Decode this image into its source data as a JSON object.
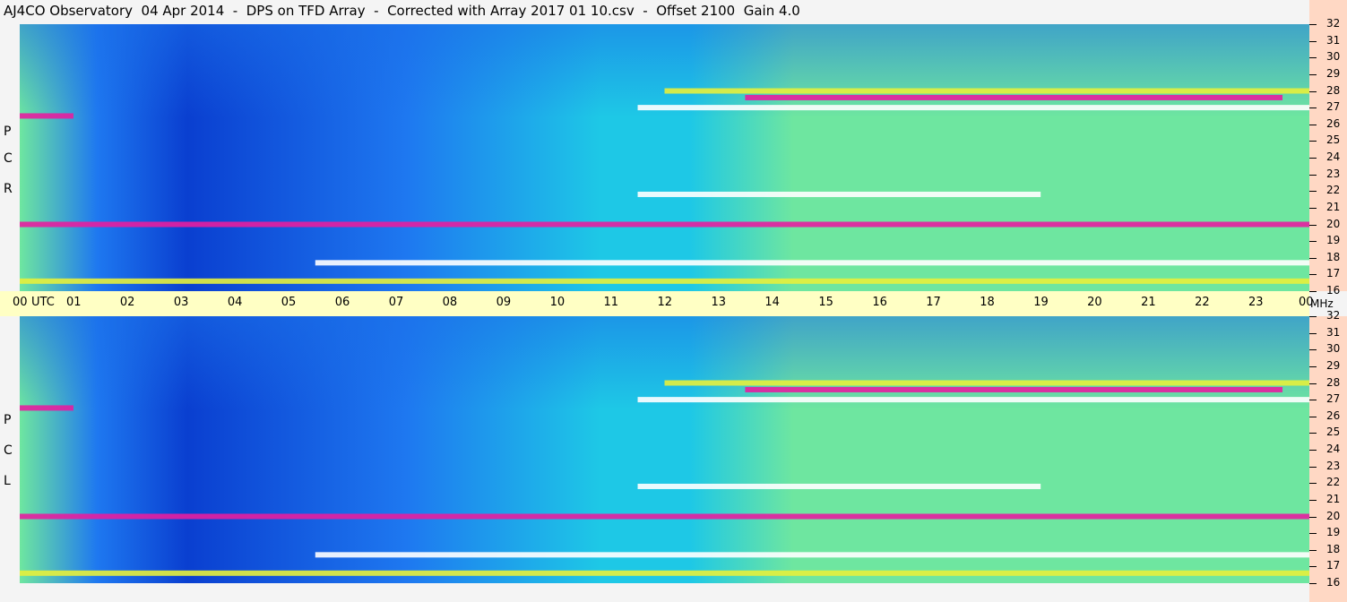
{
  "title": "AJ4CO Observatory  04 Apr 2014  -  DPS on TFD Array  -  Corrected with Array 2017 01 10.csv  -  Offset 2100  Gain 4.0",
  "panels": [
    {
      "id": "rcp",
      "label_chars": [
        "P",
        "C",
        "R"
      ]
    },
    {
      "id": "lcp",
      "label_chars": [
        "P",
        "C",
        "L"
      ]
    }
  ],
  "colors": {
    "deep_blue": "#0a3fd0",
    "mid_blue": "#1e78f0",
    "cyan": "#1ec8e6",
    "green": "#6ee6a0",
    "yellow": "#e6f03c",
    "magenta": "#e61ea0",
    "white": "#ffffff",
    "axis_strip": "#ffffc4",
    "freq_strip": "#ffd8c4"
  },
  "chart_data": {
    "type": "heatmap",
    "x_axis": {
      "unit_label": "UTC",
      "tick_labels": [
        "00",
        "01",
        "02",
        "03",
        "04",
        "05",
        "06",
        "07",
        "08",
        "09",
        "10",
        "11",
        "12",
        "13",
        "14",
        "15",
        "16",
        "17",
        "18",
        "19",
        "20",
        "21",
        "22",
        "23",
        "00"
      ],
      "range": [
        0,
        24
      ]
    },
    "y_axis": {
      "unit_label": "MHz",
      "tick_labels": [
        "32",
        "31",
        "30",
        "29",
        "28",
        "27",
        "26",
        "25",
        "24",
        "23",
        "22",
        "21",
        "20",
        "19",
        "18",
        "17",
        "16"
      ],
      "range": [
        16,
        32
      ]
    },
    "panels": [
      "RCP",
      "LCP"
    ],
    "features": [
      {
        "kind": "band",
        "freq": 27.0,
        "start": 11.5,
        "end": 24,
        "color": "white"
      },
      {
        "kind": "band",
        "freq": 27.6,
        "start": 13.5,
        "end": 23.5,
        "color": "magenta"
      },
      {
        "kind": "band",
        "freq": 28.0,
        "start": 12.0,
        "end": 24,
        "color": "yellow"
      },
      {
        "kind": "band",
        "freq": 21.8,
        "start": 11.5,
        "end": 19.0,
        "color": "white"
      },
      {
        "kind": "band",
        "freq": 17.7,
        "start": 5.5,
        "end": 24,
        "color": "white"
      },
      {
        "kind": "band",
        "freq": 16.6,
        "start": 0,
        "end": 24,
        "color": "yellow"
      },
      {
        "kind": "band",
        "freq": 20.0,
        "start": 0,
        "end": 24,
        "color": "magenta"
      },
      {
        "kind": "band",
        "freq": 26.5,
        "start": 0,
        "end": 1.0,
        "color": "magenta"
      }
    ]
  }
}
